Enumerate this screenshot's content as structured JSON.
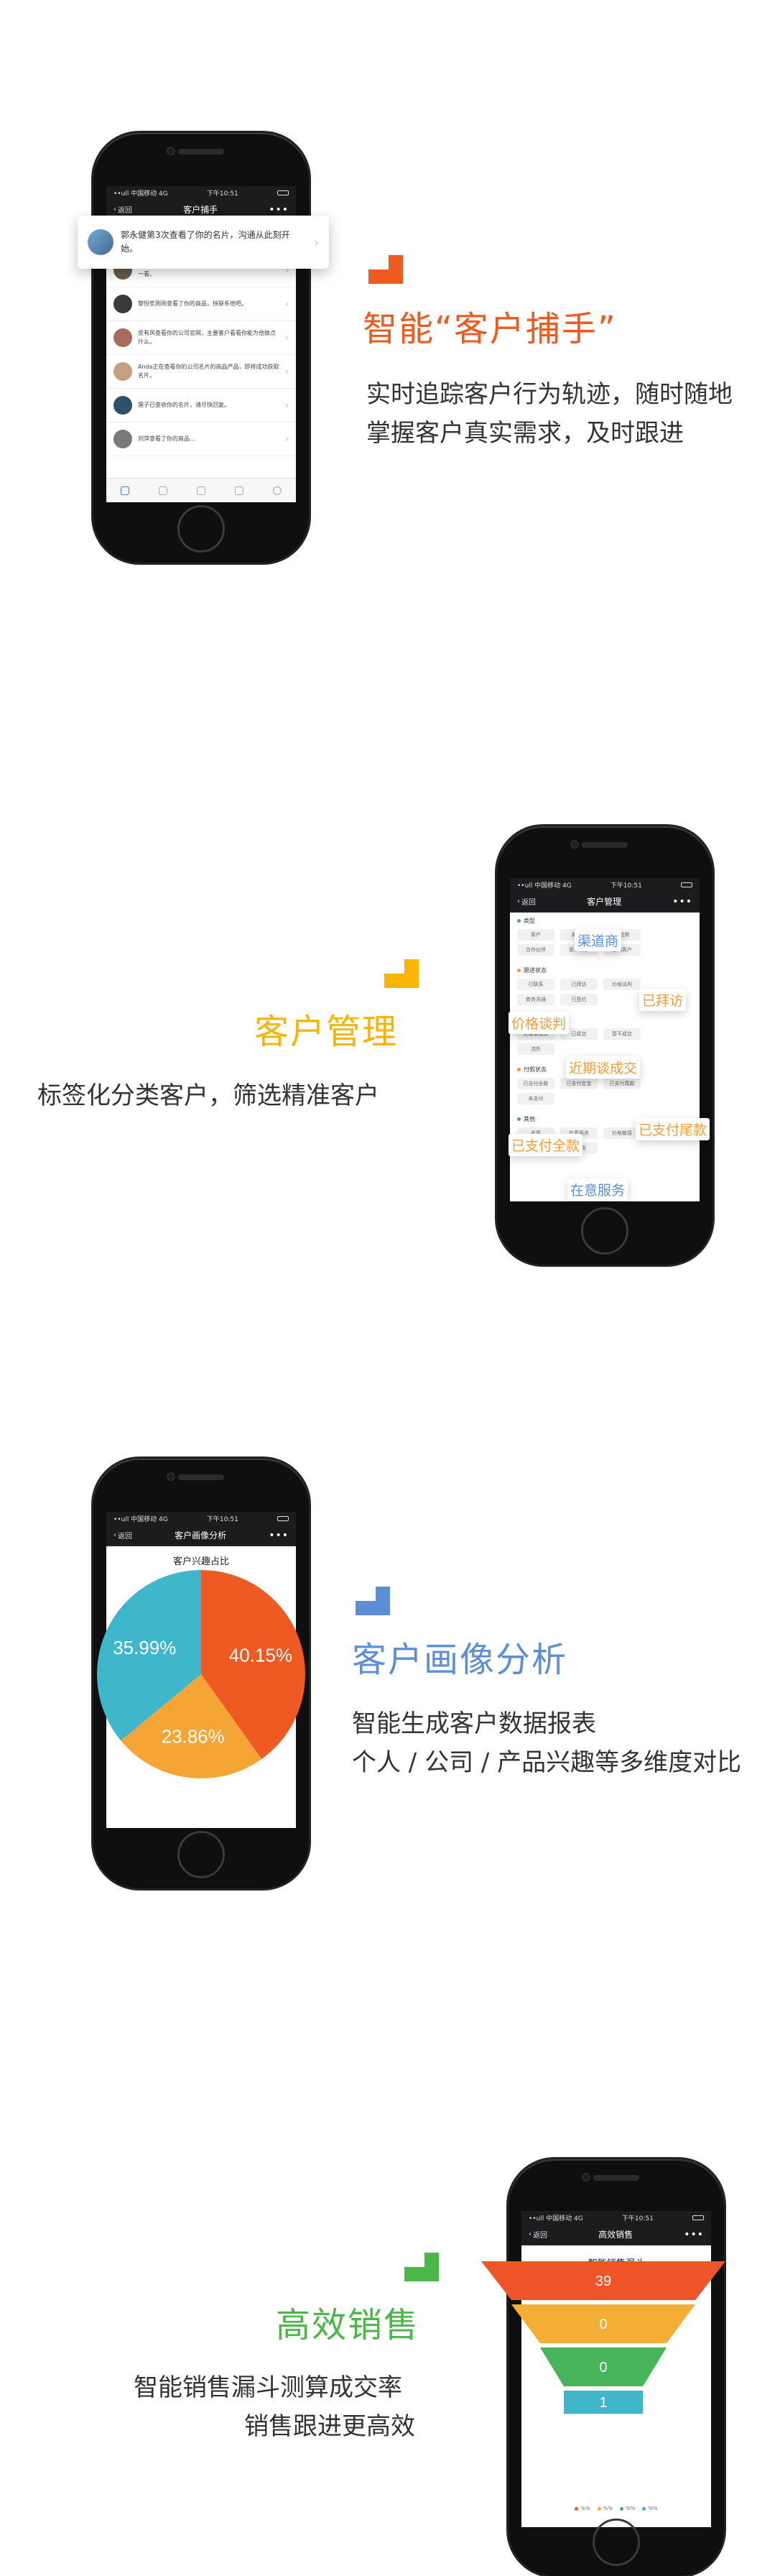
{
  "colors": {
    "orange": "#ef5a1f",
    "yellow": "#f7b500",
    "blue": "#5b8ed6",
    "green": "#4cb749",
    "pie_orange": "#ef5a22",
    "pie_yellow": "#f5a535",
    "pie_teal": "#3fb6c9",
    "funnel_red": "#f0552a",
    "funnel_yellow": "#f4ad35",
    "funnel_green": "#47b45a",
    "funnel_teal": "#3fb6c9"
  },
  "phone_common": {
    "carrier": "••ull 中国移动 4G",
    "time": "下午10:51",
    "back_label": "返回",
    "more_icon": "more-dots-icon"
  },
  "section1": {
    "title": "智能“客户捕手”",
    "desc_line1": "实时追踪客户行为轨迹，随时随地",
    "desc_line2": "掌握客户真实需求，及时跟进",
    "nav_title": "客户捕手",
    "popup_text": "郭永健第3次查看了你的名片，沟通从此刻开始。",
    "messages": [
      {
        "text": "平野Mo查看了你的官网，看看很有意思哦，说不定值得一看。"
      },
      {
        "text": "黎恒笙刚刚查看了你的商品，快联系他吧。"
      },
      {
        "text": "皮有凤查看你的公司官网，主要客户看看你能为他做点什么。"
      },
      {
        "text": "Anda正在查看你的公司名片的商品产品，即将成功获取名片。"
      },
      {
        "text": "猩子已查收你的名片，请尽快回复。"
      },
      {
        "text": "刘萍查看了你的商品..."
      }
    ]
  },
  "section2": {
    "title": "客户管理",
    "desc": "标签化分类客户，筛选精准客户",
    "nav_title": "客户管理",
    "groups": [
      {
        "title": "类型",
        "tags": [
          "客户",
          "渠道商",
          "供应商",
          "合作伙伴",
          "竞争对手",
          "意向客户"
        ]
      },
      {
        "title": "跟进状态",
        "tags": [
          "已联系",
          "已拜访",
          "价格谈判",
          "商务沟通",
          "已签约"
        ]
      },
      {
        "title": "成交状态",
        "tags": [
          "近期谈成交",
          "已成交",
          "暂不成交",
          "流失"
        ]
      },
      {
        "title": "付款状态",
        "tags": [
          "已支付全款",
          "已支付定金",
          "已支付尾款",
          "未支付"
        ]
      },
      {
        "title": "其他",
        "tags": [
          "优质",
          "在意服务",
          "价格敏感",
          "重要客户",
          "已流失"
        ]
      }
    ],
    "floating_tags": [
      {
        "text": "渠道商",
        "color": "#5b8ed6"
      },
      {
        "text": "已拜访",
        "color": "#f39c33"
      },
      {
        "text": "价格谈判",
        "color": "#f39c33"
      },
      {
        "text": "近期谈成交",
        "color": "#f39c33"
      },
      {
        "text": "已支付尾款",
        "color": "#f39c33"
      },
      {
        "text": "已支付全款",
        "color": "#f39c33"
      },
      {
        "text": "在意服务",
        "color": "#5b8ed6"
      }
    ]
  },
  "section3": {
    "title": "客户画像分析",
    "desc_line1": "智能生成客户数据报表",
    "desc_line2": "个人 / 公司 / 产品兴趣等多维度对比",
    "nav_title": "客户画像分析",
    "chart_title": "客户兴趣占比"
  },
  "section4": {
    "title": "高效销售",
    "desc_line1": "智能销售漏斗测算成交率",
    "desc_line2": "销售跟进更高效",
    "nav_title": "高效销售",
    "chart_title": "智能销售漏斗"
  },
  "chart_data": [
    {
      "type": "pie",
      "title": "客户兴趣占比",
      "values": [
        40.15,
        23.86,
        35.99
      ],
      "labels": [
        "40.15%",
        "23.86%",
        "35.99%"
      ],
      "colors": [
        "#ef5a22",
        "#f5a535",
        "#3fb6c9"
      ]
    },
    {
      "type": "bar",
      "subtype": "funnel",
      "title": "智能销售漏斗",
      "values": [
        39,
        0,
        0,
        1
      ],
      "colors": [
        "#f0552a",
        "#f4ad35",
        "#47b45a",
        "#3fb6c9"
      ],
      "legend": [
        "%%",
        "%%",
        "%%",
        "%%"
      ]
    }
  ]
}
